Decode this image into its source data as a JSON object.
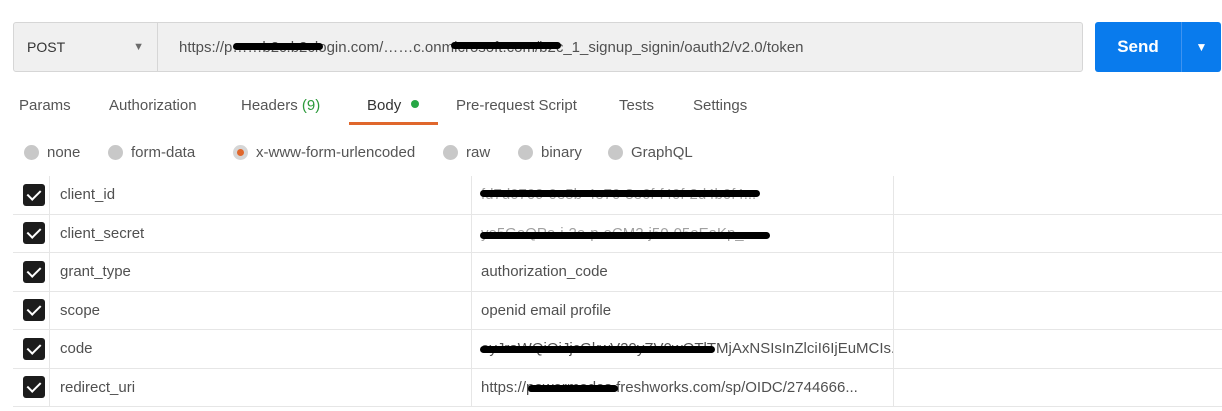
{
  "request": {
    "method": "POST",
    "url": "https://p……b2c.b2clogin.com/……c.onmicrosoft.com/b2c_1_signup_signin/oauth2/v2.0/token",
    "send_label": "Send"
  },
  "tabs": [
    {
      "label": "Params"
    },
    {
      "label": "Authorization"
    },
    {
      "label": "Headers",
      "count": "(9)"
    },
    {
      "label": "Body"
    },
    {
      "label": "Pre-request Script"
    },
    {
      "label": "Tests"
    },
    {
      "label": "Settings"
    }
  ],
  "body_types": [
    {
      "label": "none"
    },
    {
      "label": "form-data"
    },
    {
      "label": "x-www-form-urlencoded"
    },
    {
      "label": "raw"
    },
    {
      "label": "binary"
    },
    {
      "label": "GraphQL"
    }
  ],
  "params": [
    {
      "key": "client_id",
      "value": "fd7d0709-0e5b-4e70-8e6f-f40f-2d4b0f4..."
    },
    {
      "key": "client_secret",
      "value": "yo5GeQPo-i-2e-p-oCM2-j50-05oEaKp_"
    },
    {
      "key": "grant_type",
      "value": "authorization_code"
    },
    {
      "key": "scope",
      "value": "openid email profile"
    },
    {
      "key": "code",
      "value": "eyJraWQiOiJjcGkwV29yZV0wOTlTMjAxNSIsInZlciI6IjEuMCIs..."
    },
    {
      "key": "redirect_uri",
      "value": "https://powermodes.freshworks.com/sp/OIDC/2744666..."
    }
  ],
  "colors": {
    "send": "#097bed",
    "active_tab": "#e0672c",
    "body_dot": "#27a745",
    "headers_count": "#2b9a3a"
  }
}
